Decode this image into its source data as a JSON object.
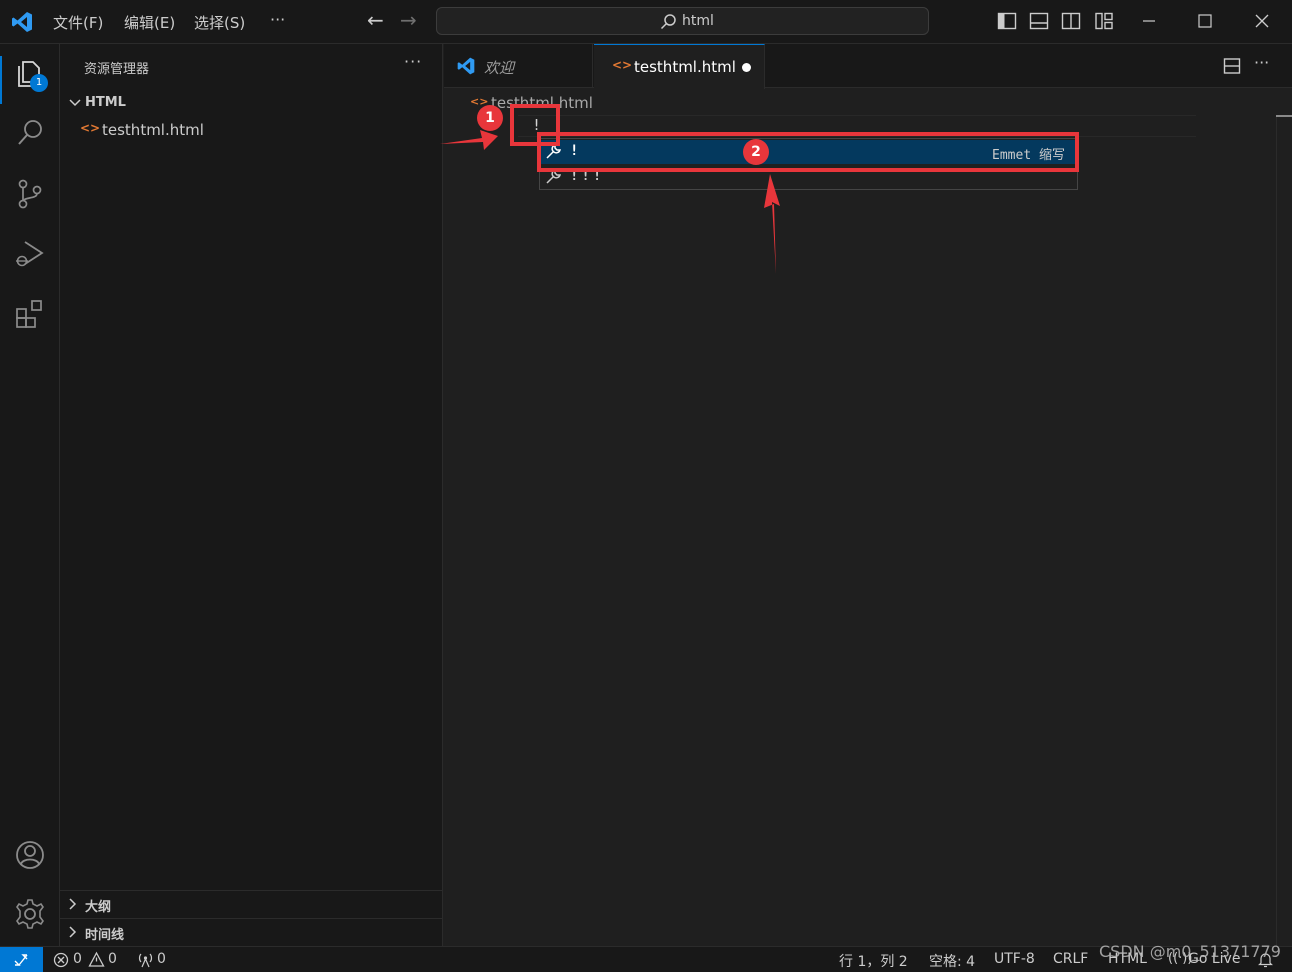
{
  "titlebar": {
    "menu": [
      "文件(F)",
      "编辑(E)",
      "选择(S)"
    ],
    "more": "···",
    "search_text": "html"
  },
  "activity": {
    "explorer_badge": "1"
  },
  "sidebar": {
    "title": "资源管理器",
    "more": "···",
    "folder": "HTML",
    "file": "testhtml.html",
    "sections": [
      "大纲",
      "时间线"
    ]
  },
  "tabs": {
    "welcome": "欢迎",
    "file": "testhtml.html"
  },
  "editor": {
    "breadcrumb": "testhtml.html",
    "code_line": "!",
    "file_icon": "<>"
  },
  "suggest": {
    "items": [
      {
        "label": "!",
        "detail": "Emmet 缩写"
      },
      {
        "label": "!!!",
        "detail": ""
      }
    ]
  },
  "annotations": {
    "circle1": "1",
    "circle2": "2",
    "color": "#e8363b"
  },
  "statusbar": {
    "errors": "0",
    "warnings": "0",
    "ports": "0",
    "position": "行 1，列 2",
    "spaces": "空格: 4",
    "encoding": "UTF-8",
    "eol": "CRLF",
    "language": "HTML",
    "golive": "Go Live"
  },
  "watermark": "CSDN @m0_51371779",
  "colors": {
    "accent": "#0078d4",
    "background": "#1f1f1f",
    "selection": "#04395e",
    "html_icon": "#e37933"
  }
}
